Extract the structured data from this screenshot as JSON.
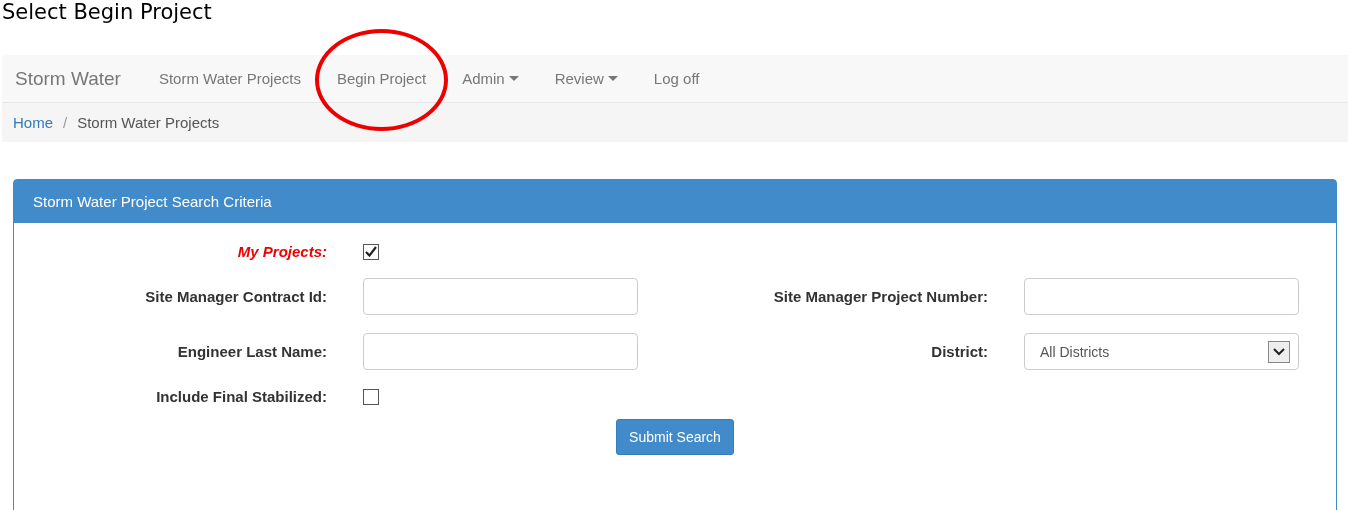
{
  "caption": "Select Begin Project",
  "navbar": {
    "brand": "Storm Water",
    "items": [
      {
        "label": "Storm Water Projects",
        "dropdown": false,
        "highlighted": false
      },
      {
        "label": "Begin Project",
        "dropdown": false,
        "highlighted": true
      },
      {
        "label": "Admin",
        "dropdown": true,
        "highlighted": false
      },
      {
        "label": "Review",
        "dropdown": true,
        "highlighted": false
      },
      {
        "label": "Log off",
        "dropdown": false,
        "highlighted": false
      }
    ]
  },
  "breadcrumb": {
    "separator": "/",
    "links": [
      {
        "label": "Home",
        "current": false
      },
      {
        "label": "Storm Water Projects",
        "current": true
      }
    ]
  },
  "panel": {
    "title": "Storm Water Project Search Criteria",
    "rows": [
      [
        {
          "kind": "checkbox",
          "label": "My Projects:",
          "emphasized": true,
          "checked": true
        }
      ],
      [
        {
          "kind": "text",
          "label": "Site Manager Contract Id:",
          "emphasized": false
        },
        {
          "kind": "text",
          "label": "Site Manager Project Number:",
          "emphasized": false
        }
      ],
      [
        {
          "kind": "text",
          "label": "Engineer Last Name:",
          "emphasized": false
        },
        {
          "kind": "select",
          "label": "District:",
          "emphasized": false,
          "value": "All Districts"
        }
      ],
      [
        {
          "kind": "checkbox",
          "label": "Include Final Stabilized:",
          "emphasized": false,
          "checked": false
        }
      ]
    ],
    "submit": "Submit Search"
  }
}
